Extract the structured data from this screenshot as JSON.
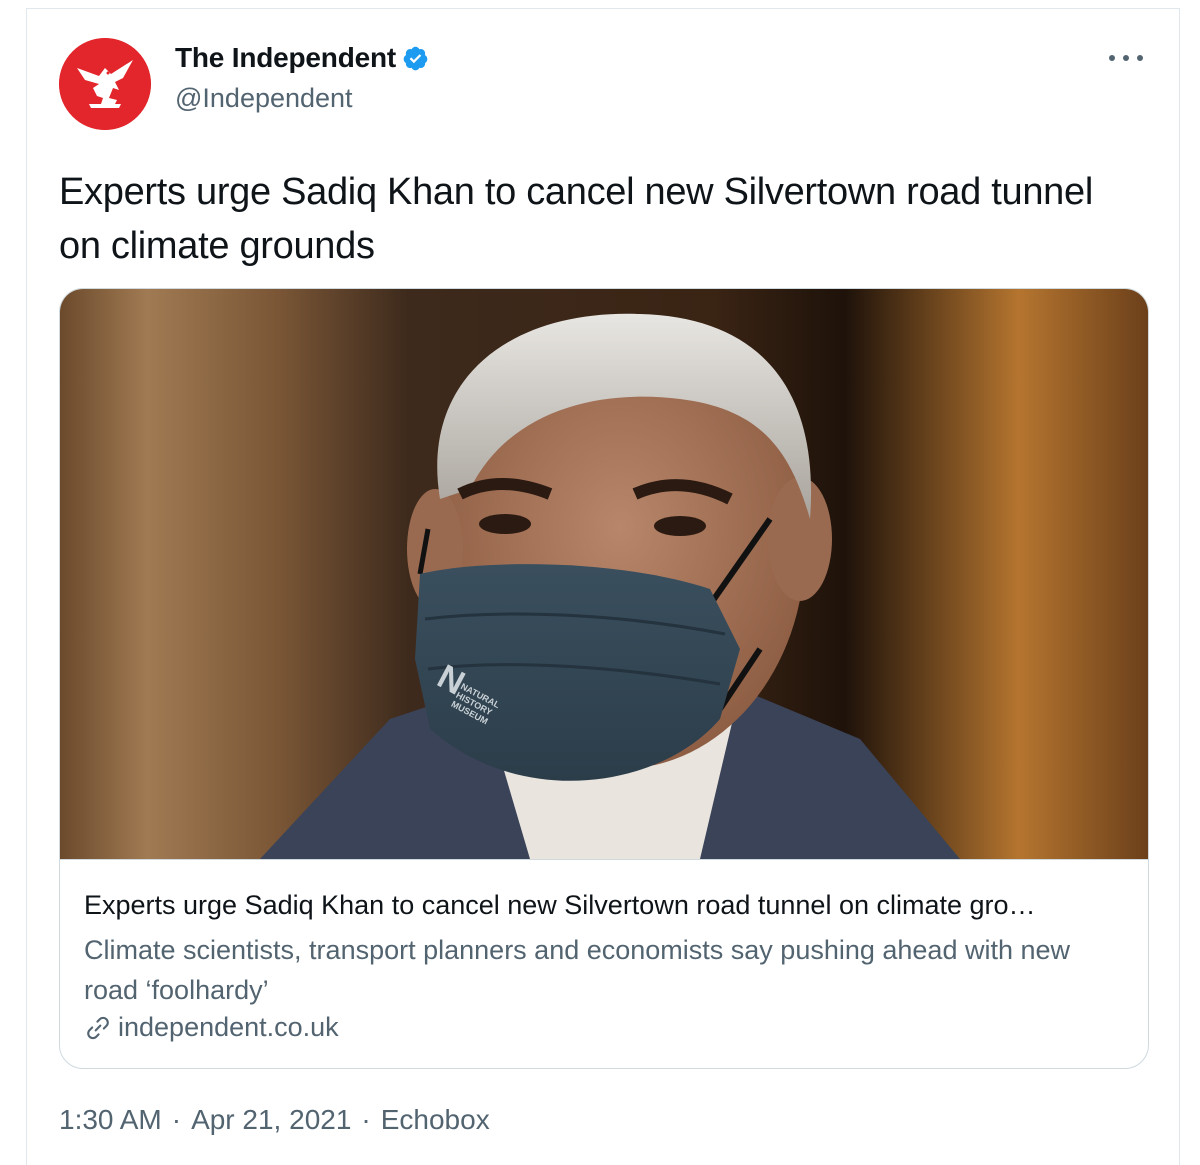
{
  "author": {
    "display_name": "The Independent",
    "handle": "@Independent",
    "verified": true,
    "avatar_icon": "eagle-logo-icon",
    "brand_color": "#e2262b"
  },
  "tweet": {
    "text": "Experts urge Sadiq Khan to cancel new Silvertown road tunnel on climate grounds"
  },
  "card": {
    "image_description": "photo-of-man-in-face-mask",
    "mask_text": "NATURAL HISTORY MUSEUM",
    "title": "Experts urge Sadiq Khan to cancel new Silvertown road tunnel on climate gro…",
    "description": "Climate scientists, transport planners and economists say pushing ahead with new road ‘foolhardy’",
    "domain": "independent.co.uk"
  },
  "meta": {
    "time": "1:30 AM",
    "separator": "·",
    "date": "Apr 21, 2021",
    "source": "Echobox"
  },
  "colors": {
    "text_primary": "#0f1419",
    "text_secondary": "#536471",
    "verified_blue": "#1d9bf0",
    "border": "#cfd9de"
  }
}
